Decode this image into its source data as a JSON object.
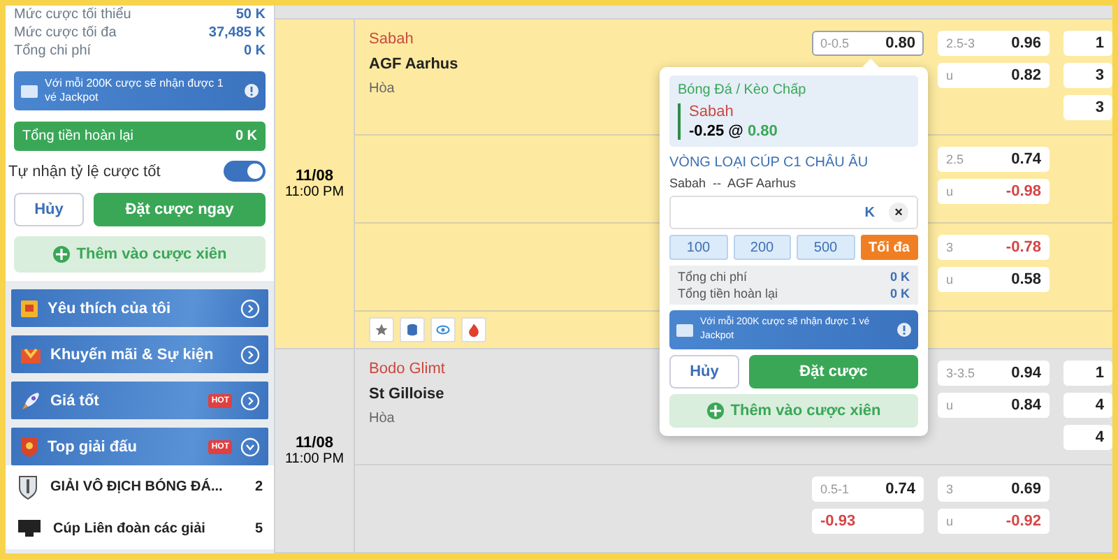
{
  "sidebar": {
    "limits": [
      {
        "label": "Mức cược tối thiểu",
        "value": "50 K"
      },
      {
        "label": "Mức cược tối đa",
        "value": "37,485 K"
      },
      {
        "label": "Tổng chi phí",
        "value": "0 K"
      }
    ],
    "jackpot": "Với mỗi 200K cược sẽ nhận được 1 vé Jackpot",
    "refund": {
      "label": "Tổng tiền hoàn lại",
      "value": "0 K"
    },
    "auto_accept": {
      "label": "Tự nhận tỷ lệ cược tốt",
      "on": true
    },
    "cancel_button": "Hủy",
    "place_button": "Đặt cược ngay",
    "parlay_button": "Thêm vào cược xiên",
    "menu": [
      {
        "kind": "favorite",
        "label": "Yêu thích của tôi",
        "expanded": false
      },
      {
        "kind": "promo",
        "label": "Khuyến mãi & Sự kiện",
        "expanded": false
      },
      {
        "kind": "rocket",
        "label": "Giá tốt",
        "badge": "HOT",
        "expanded": false
      },
      {
        "kind": "shield",
        "label": "Top giải đấu",
        "badge": "HOT",
        "expanded": true
      }
    ],
    "leagues": [
      {
        "kind": "trophy",
        "name": "GIẢI VÔ ĐỊCH BÓNG ĐÁ...",
        "count": "2"
      },
      {
        "kind": "screen",
        "name": "Cúp Liên đoàn các giải",
        "count": "5"
      }
    ]
  },
  "matches": [
    {
      "date": "11/08",
      "time": "11:00 PM",
      "highlighted": true,
      "home": "Sabah",
      "away": "AGF Aarhus",
      "draw": "Hòa",
      "tools": true,
      "lines": [
        {
          "col1": [
            {
              "label": "0-0.5",
              "value": "0.80",
              "negative": false,
              "selected": true
            }
          ],
          "col2": [
            {
              "label": "2.5-3",
              "value": "0.96",
              "negative": false,
              "selected": false
            },
            {
              "label": "u",
              "value": "0.82",
              "negative": false,
              "selected": false
            }
          ],
          "col3": [
            {
              "value": "1",
              "negative": false,
              "selected": false
            },
            {
              "value": "3",
              "negative": false,
              "selected": false
            },
            {
              "value": "3",
              "negative": false,
              "selected": false
            }
          ]
        },
        {
          "col2": [
            {
              "label": "2.5",
              "value": "0.74",
              "negative": false,
              "selected": false
            },
            {
              "label": "u",
              "value": "-0.98",
              "negative": true,
              "selected": false
            }
          ]
        },
        {
          "col2": [
            {
              "label": "3",
              "value": "-0.78",
              "negative": true,
              "selected": false
            },
            {
              "label": "u",
              "value": "0.58",
              "negative": false,
              "selected": false
            }
          ]
        }
      ]
    },
    {
      "date": "11/08",
      "time": "11:00 PM",
      "highlighted": false,
      "home": "Bodo Glimt",
      "away": "St Gilloise",
      "draw": "Hòa",
      "tools": false,
      "lines": [
        {
          "col2": [
            {
              "label": "3-3.5",
              "value": "0.94",
              "negative": false,
              "selected": false
            },
            {
              "label": "u",
              "value": "0.84",
              "negative": false,
              "selected": false
            }
          ],
          "col3": [
            {
              "value": "1",
              "negative": false,
              "selected": false
            },
            {
              "value": "4",
              "negative": false,
              "selected": false
            },
            {
              "value": "4",
              "negative": false,
              "selected": false
            }
          ]
        },
        {
          "col1": [
            {
              "label": "0.5-1",
              "value": "0.74",
              "negative": false,
              "selected": false
            },
            {
              "value": "-0.93",
              "negative": true,
              "selected": false
            }
          ],
          "col2": [
            {
              "label": "3",
              "value": "0.69",
              "negative": false,
              "selected": false
            },
            {
              "label": "u",
              "value": "-0.92",
              "negative": true,
              "selected": false
            }
          ]
        }
      ]
    }
  ],
  "bet_slip": {
    "market": "Bóng Đá / Kèo Chấp",
    "team": "Sabah",
    "handicap": "-0.25",
    "at": "@",
    "odds": "0.80",
    "league": "VÒNG LOẠI CÚP C1 CHÂU ÂU",
    "fixture": "Sabah  --  AGF Aarhus",
    "unit": "K",
    "clear": "×",
    "quick_amounts": [
      {
        "label": "100",
        "kind": "amount"
      },
      {
        "label": "200",
        "kind": "amount"
      },
      {
        "label": "500",
        "kind": "amount"
      },
      {
        "label": "Tối đa",
        "kind": "max"
      }
    ],
    "totals": [
      {
        "label": "Tổng chi phí",
        "value": "0 K"
      },
      {
        "label": "Tổng tiền hoàn lại",
        "value": "0 K"
      }
    ],
    "jackpot": "Với mỗi 200K cược sẽ nhận được 1 vé Jackpot",
    "cancel_button": "Hủy",
    "place_button": "Đặt cược",
    "parlay_button": "Thêm vào cược xiên"
  }
}
